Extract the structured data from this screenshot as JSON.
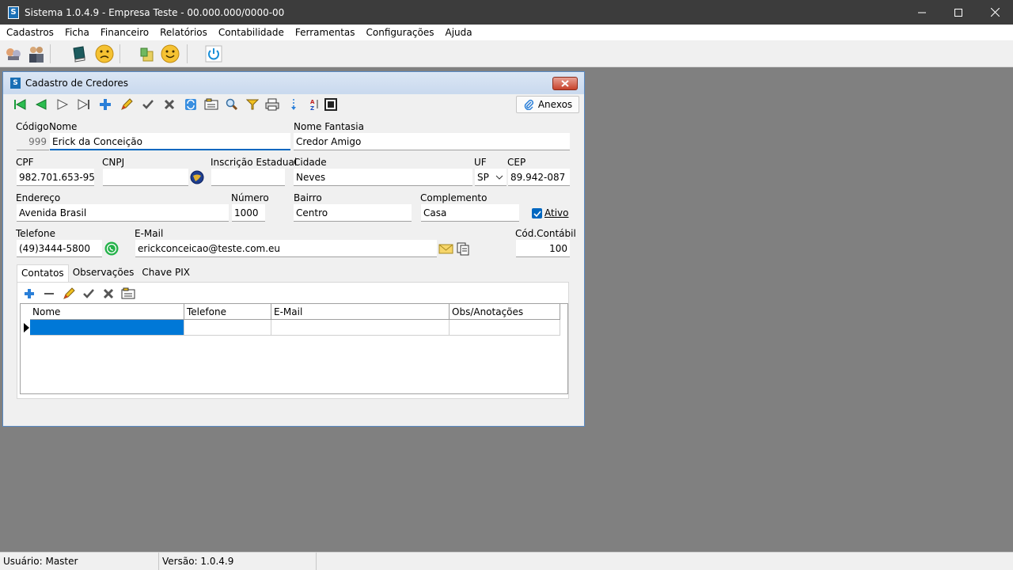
{
  "window": {
    "title": "Sistema 1.0.4.9 - Empresa Teste - 00.000.000/0000-00",
    "app_icon_letter": "S"
  },
  "menu": [
    "Cadastros",
    "Ficha",
    "Financeiro",
    "Relatórios",
    "Contabilidade",
    "Ferramentas",
    "Configurações",
    "Ajuda"
  ],
  "form": {
    "title": "Cadastro de Credores",
    "anexos_label": "Anexos",
    "labels": {
      "codigo": "Código",
      "nome": "Nome",
      "nome_fantasia": "Nome Fantasia",
      "cpf": "CPF",
      "cnpj": "CNPJ",
      "inscricao": "Inscrição Estadual",
      "cidade": "Cidade",
      "uf": "UF",
      "cep": "CEP",
      "endereco": "Endereço",
      "numero": "Número",
      "bairro": "Bairro",
      "complemento": "Complemento",
      "ativo": "Ativo",
      "telefone": "Telefone",
      "email": "E-Mail",
      "cod_contabil": "Cód.Contábil"
    },
    "values": {
      "codigo": "999",
      "nome": "Erick da Conceição",
      "nome_fantasia": "Credor Amigo",
      "cpf": "982.701.653-95",
      "cnpj": "",
      "inscricao": "",
      "cidade": "Neves",
      "uf": "SP",
      "cep": "89.942-087",
      "endereco": "Avenida Brasil",
      "numero": "1000",
      "bairro": "Centro",
      "complemento": "Casa",
      "telefone": "(49)3444-5800",
      "email": "erickconceicao@teste.com.eu",
      "cod_contabil": "100"
    },
    "ativo_checked": true,
    "tabs": [
      "Contatos",
      "Observações",
      "Chave PIX"
    ],
    "grid_columns": [
      "Nome",
      "Telefone",
      "E-Mail",
      "Obs/Anotações"
    ]
  },
  "status": {
    "usuario": "Usuário: Master",
    "versao": "Versão: 1.0.4.9"
  },
  "colors": {
    "accent": "#0067c0",
    "selection": "#0078d7",
    "title_bar": "#3c3c3c",
    "mdi_bg": "#808080"
  }
}
